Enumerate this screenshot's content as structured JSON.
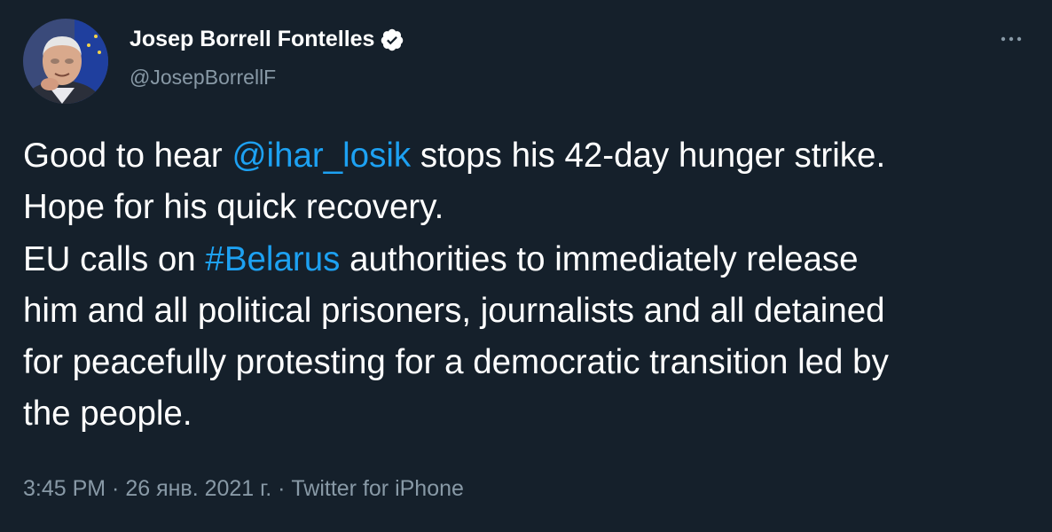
{
  "author": {
    "display_name": "Josep Borrell Fontelles",
    "handle": "@JosepBorrellF",
    "verified": true,
    "avatar_icon": "author-portrait"
  },
  "menu": {
    "icon": "more-horizontal-icon"
  },
  "tweet": {
    "line1_pre": "Good to hear ",
    "mention": "@ihar_losik",
    "line1_post": " stops his 42-day hunger strike.",
    "line2": "Hope for his quick recovery.",
    "line3_pre": "EU calls on ",
    "hashtag": "#Belarus",
    "line3_post": " authorities to immediately release",
    "line4": "him and all political prisoners, journalists and all detained",
    "line5": "for peacefully protesting for a democratic transition led by",
    "line6": "the people."
  },
  "meta": {
    "time": "3:45 PM",
    "sep1": " · ",
    "date": "26 янв. 2021 г.",
    "sep2": " · ",
    "source": "Twitter for iPhone"
  },
  "colors": {
    "background": "#15202b",
    "link": "#1da1f2",
    "secondary_text": "#8899a6",
    "primary_text": "#ffffff"
  }
}
